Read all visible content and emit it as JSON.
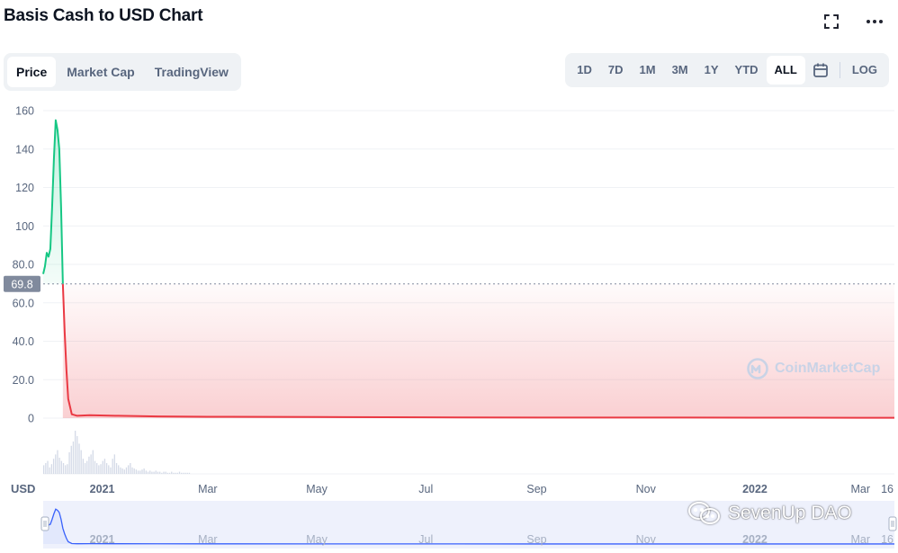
{
  "header": {
    "title": "Basis Cash to USD Chart"
  },
  "icons": {
    "fullscreen": "fullscreen-icon",
    "more": "more-icon",
    "calendar": "calendar-icon"
  },
  "tabs": [
    {
      "label": "Price",
      "active": true
    },
    {
      "label": "Market Cap",
      "active": false
    },
    {
      "label": "TradingView",
      "active": false
    }
  ],
  "ranges": [
    {
      "label": "1D",
      "active": false
    },
    {
      "label": "7D",
      "active": false
    },
    {
      "label": "1M",
      "active": false
    },
    {
      "label": "3M",
      "active": false
    },
    {
      "label": "1Y",
      "active": false
    },
    {
      "label": "YTD",
      "active": false
    },
    {
      "label": "ALL",
      "active": true
    }
  ],
  "log_label": "LOG",
  "watermark": "CoinMarketCap",
  "overlay_text": "SevenUp DAO",
  "colors": {
    "up": "#16c784",
    "down": "#ea3943",
    "navigator_fill": "#eef1fc",
    "navigator_line": "#3861fb",
    "current_price_tag": "#808a9d"
  },
  "chart_data": {
    "type": "line",
    "title": "Basis Cash to USD Chart",
    "ylim": [
      0,
      160
    ],
    "yticks": [
      "160",
      "140",
      "120",
      "100",
      "80.0",
      "60.0",
      "40.0",
      "20.0",
      "0"
    ],
    "current_price": 69.8,
    "current_price_label": "69.8",
    "x_unit_label": "USD",
    "x_ticks": [
      {
        "label": "2021",
        "date": "2021-01-01",
        "bold": true
      },
      {
        "label": "Mar",
        "date": "2021-03-01",
        "bold": false
      },
      {
        "label": "May",
        "date": "2021-05-01",
        "bold": false
      },
      {
        "label": "Jul",
        "date": "2021-07-01",
        "bold": false
      },
      {
        "label": "Sep",
        "date": "2021-09-01",
        "bold": false
      },
      {
        "label": "Nov",
        "date": "2021-11-01",
        "bold": false
      },
      {
        "label": "2022",
        "date": "2022-01-01",
        "bold": true
      },
      {
        "label": "Mar",
        "date": "2022-03-01",
        "bold": false
      },
      {
        "label": "16",
        "date": "2022-03-16",
        "bold": false
      }
    ],
    "x_range": [
      "2020-11-29",
      "2022-03-20"
    ],
    "series": [
      {
        "points": [
          [
            "2020-11-29",
            75
          ],
          [
            "2020-11-30",
            79
          ],
          [
            "2020-12-01",
            86
          ],
          [
            "2020-12-02",
            84
          ],
          [
            "2020-12-03",
            88
          ],
          [
            "2020-12-04",
            110
          ],
          [
            "2020-12-05",
            135
          ],
          [
            "2020-12-06",
            155
          ],
          [
            "2020-12-07",
            150
          ],
          [
            "2020-12-08",
            140
          ],
          [
            "2020-12-09",
            110
          ],
          [
            "2020-12-10",
            69.8
          ],
          [
            "2020-12-11",
            45
          ],
          [
            "2020-12-12",
            25
          ],
          [
            "2020-12-13",
            10
          ],
          [
            "2020-12-15",
            2
          ],
          [
            "2020-12-18",
            1.2
          ],
          [
            "2020-12-25",
            1.5
          ],
          [
            "2021-01-10",
            1.2
          ],
          [
            "2021-02-01",
            0.9
          ],
          [
            "2021-03-01",
            0.7
          ],
          [
            "2021-05-01",
            0.6
          ],
          [
            "2021-07-01",
            0.4
          ],
          [
            "2021-09-01",
            0.3
          ],
          [
            "2021-11-01",
            0.3
          ],
          [
            "2022-01-01",
            0.25
          ],
          [
            "2022-03-01",
            0.2
          ],
          [
            "2022-03-20",
            0.2
          ]
        ]
      }
    ],
    "volume": {
      "start": "2020-11-29",
      "values": [
        8,
        10,
        12,
        6,
        9,
        14,
        18,
        22,
        15,
        12,
        10,
        8,
        9,
        20,
        26,
        30,
        40,
        35,
        28,
        22,
        14,
        10,
        12,
        16,
        18,
        22,
        12,
        10,
        8,
        9,
        12,
        14,
        10,
        8,
        6,
        14,
        18,
        10,
        8,
        6,
        5,
        4,
        6,
        8,
        10,
        6,
        5,
        4,
        3,
        3,
        4,
        5,
        3,
        2,
        3,
        2,
        2,
        3,
        2,
        2,
        1,
        2,
        2,
        1,
        1,
        2,
        1,
        1,
        1,
        2,
        1,
        1,
        1,
        1,
        1
      ]
    },
    "grid": true
  }
}
